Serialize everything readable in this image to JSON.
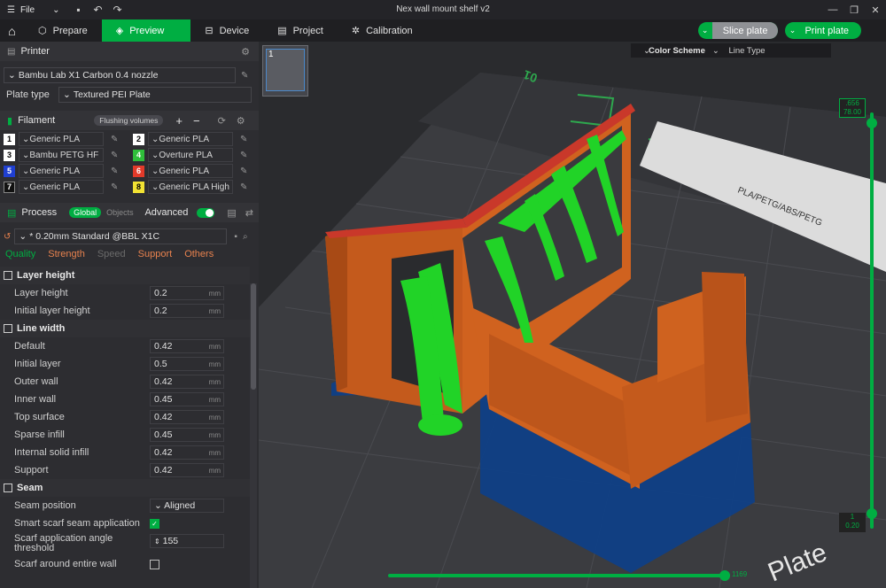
{
  "window": {
    "title": "Nex wall mount shelf v2",
    "file_menu": "File"
  },
  "tabs": [
    {
      "label": "Prepare",
      "icon": "cube-icon"
    },
    {
      "label": "Preview",
      "icon": "layers-icon"
    },
    {
      "label": "Device",
      "icon": "device-icon"
    },
    {
      "label": "Project",
      "icon": "project-icon"
    },
    {
      "label": "Calibration",
      "icon": "calibration-icon"
    }
  ],
  "actions": {
    "slice": "Slice plate",
    "print": "Print plate"
  },
  "printer": {
    "header": "Printer",
    "name": "Bambu Lab X1 Carbon 0.4 nozzle",
    "plate_type_label": "Plate type",
    "plate_type": "Textured PEI Plate"
  },
  "filament": {
    "header": "Filament",
    "flushing": "Flushing volumes",
    "items": [
      {
        "n": "1",
        "color": "#ffffff",
        "name": "Generic PLA"
      },
      {
        "n": "2",
        "color": "#ffffff",
        "name": "Generic PLA"
      },
      {
        "n": "3",
        "color": "#ffffff",
        "name": "Bambu PETG HF"
      },
      {
        "n": "4",
        "color": "#2fbf3a",
        "name": "Overture PLA"
      },
      {
        "n": "5",
        "color": "#1f3fd0",
        "name": "Generic PLA"
      },
      {
        "n": "6",
        "color": "#e23a2a",
        "name": "Generic PLA"
      },
      {
        "n": "7",
        "color": "#111111",
        "name": "Generic PLA"
      },
      {
        "n": "8",
        "color": "#f2e233",
        "name": "Generic PLA High S..."
      }
    ]
  },
  "process": {
    "header": "Process",
    "global": "Global",
    "objects": "Objects",
    "advanced": "Advanced",
    "preset": "* 0.20mm Standard @BBL X1C",
    "tabs": [
      "Quality",
      "Strength",
      "Speed",
      "Support",
      "Others"
    ]
  },
  "params": {
    "layer_height_group": "Layer height",
    "layer_height": {
      "label": "Layer height",
      "value": "0.2",
      "unit": "mm"
    },
    "initial_layer_height": {
      "label": "Initial layer height",
      "value": "0.2",
      "unit": "mm"
    },
    "line_width_group": "Line width",
    "default": {
      "label": "Default",
      "value": "0.42",
      "unit": "mm"
    },
    "initial_layer": {
      "label": "Initial layer",
      "value": "0.5",
      "unit": "mm"
    },
    "outer_wall": {
      "label": "Outer wall",
      "value": "0.42",
      "unit": "mm"
    },
    "inner_wall": {
      "label": "Inner wall",
      "value": "0.45",
      "unit": "mm"
    },
    "top_surface": {
      "label": "Top surface",
      "value": "0.42",
      "unit": "mm"
    },
    "sparse_infill": {
      "label": "Sparse infill",
      "value": "0.45",
      "unit": "mm"
    },
    "internal_solid_infill": {
      "label": "Internal solid infill",
      "value": "0.42",
      "unit": "mm"
    },
    "support": {
      "label": "Support",
      "value": "0.42",
      "unit": "mm"
    },
    "seam_group": "Seam",
    "seam_position": {
      "label": "Seam position",
      "value": "Aligned"
    },
    "smart_scarf": {
      "label": "Smart scarf seam application"
    },
    "scarf_angle": {
      "label1": "Scarf application angle",
      "label2": "threshold",
      "value": "155"
    },
    "scarf_entire": {
      "label": "Scarf around entire wall"
    }
  },
  "viewport": {
    "color_scheme_label": "Color Scheme",
    "color_scheme_value": "Line Type",
    "plate_number": "1",
    "bed_label": "01",
    "bed_text": "PLA/PETG/ABS/PETG",
    "bed_corner": "Plate",
    "layer_top": ".656",
    "layer_top2": "78.00",
    "layer_bottom": "1",
    "layer_bottom2": "0.20",
    "move_value": "1169"
  }
}
